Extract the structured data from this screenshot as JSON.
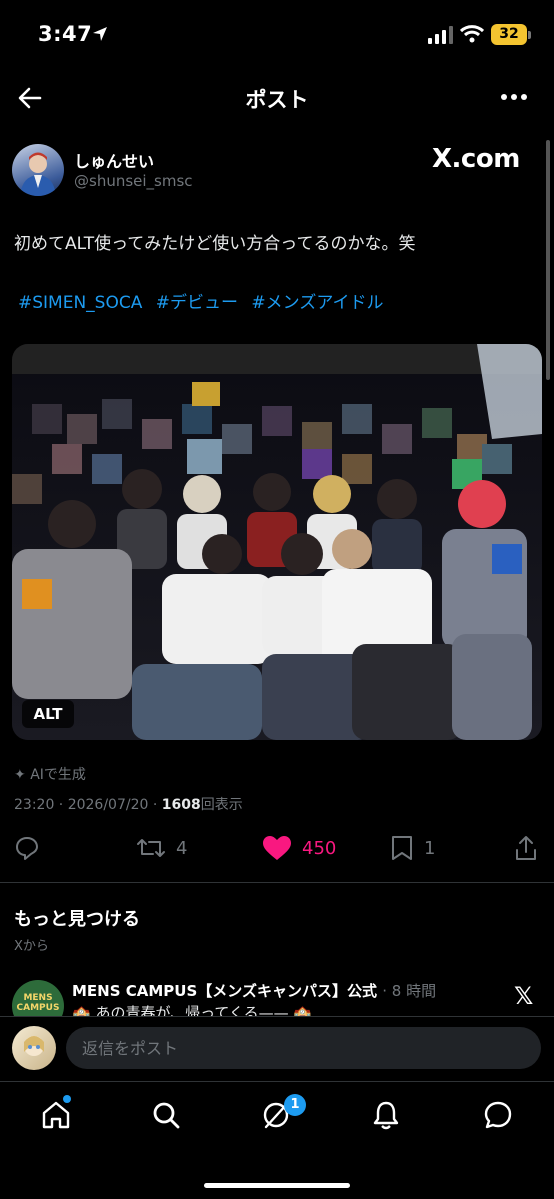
{
  "status_bar": {
    "time": "3:47",
    "battery": "32"
  },
  "header": {
    "title": "ポスト"
  },
  "post": {
    "display_name": "しゅんせい",
    "handle": "@shunsei_smsc",
    "source_badge": "X.com",
    "text": "初めてALT使ってみたけど使い方合ってるのかな。笑",
    "hashtags": [
      "#SIMEN_SOCA",
      "#デビュー",
      "#メンズアイドル"
    ],
    "alt_badge": "ALT",
    "ai_label": "AIで生成",
    "timestamp": "23:20 · 2026/07/20 · ",
    "views_count": "1608",
    "views_label": "回表示",
    "reposts": "4",
    "likes": "450",
    "bookmarks": "1"
  },
  "discover": {
    "title": "もっと見つける",
    "subtitle": "Xから",
    "suggestion": {
      "name": "MENS CAMPUS【メンズキャンパス】公式",
      "time": "· 8 時間",
      "preview": "🏫 あの青春が、帰ってくる—— 🏫",
      "avatar_text": "MENS CAMPUS"
    }
  },
  "reply": {
    "placeholder": "返信をポスト"
  },
  "nav": {
    "grok_badge": "1"
  },
  "colors": {
    "accent": "#1d9bf0",
    "like": "#f91880",
    "muted": "#71767b",
    "background": "#000000"
  }
}
